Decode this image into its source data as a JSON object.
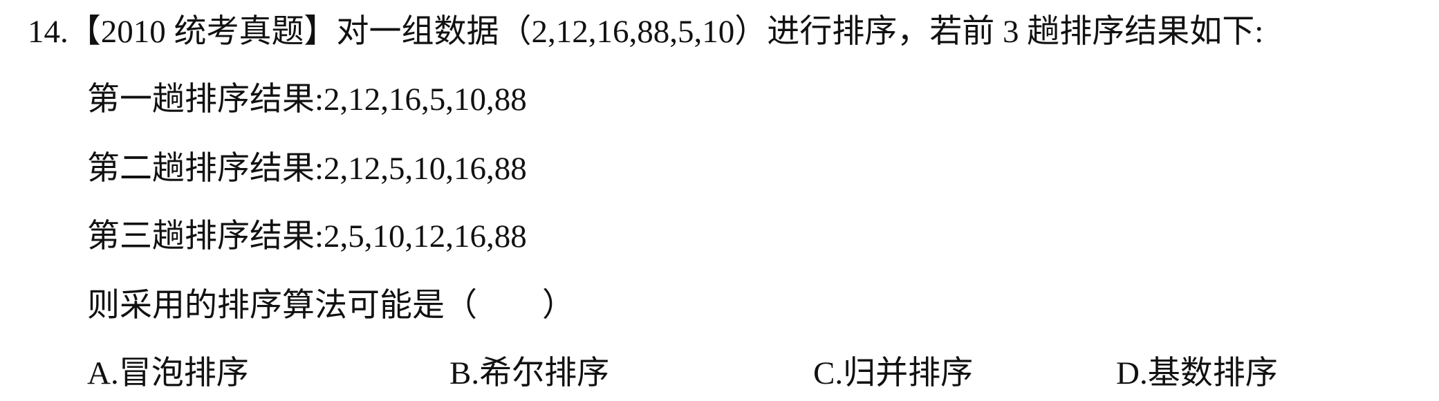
{
  "question": {
    "stem": "14.【2010 统考真题】对一组数据（2,12,16,88,5,10）进行排序，若前 3 趟排序结果如下:",
    "passes": [
      "第一趟排序结果:2,12,16,5,10,88",
      "第二趟排序结果:2,12,5,10,16,88",
      "第三趟排序结果:2,5,10,12,16,88"
    ],
    "prompt": "则采用的排序算法可能是（　　）",
    "options": [
      "A.冒泡排序",
      "B.希尔排序",
      "C.归并排序",
      "D.基数排序"
    ]
  }
}
